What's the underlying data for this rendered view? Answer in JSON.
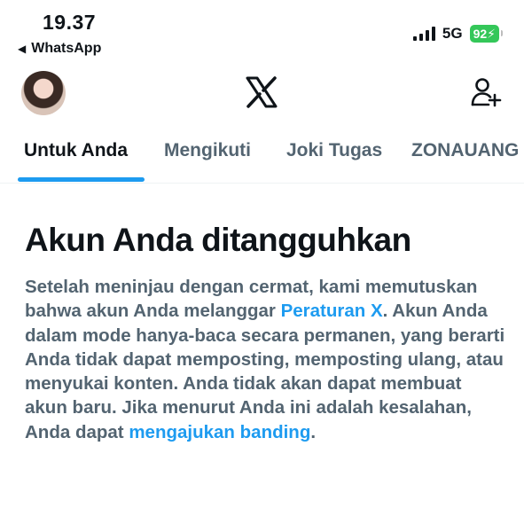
{
  "status_bar": {
    "time": "19.37",
    "back_app": "WhatsApp",
    "network": "5G",
    "battery": "92"
  },
  "header": {
    "avatar_icon": "user-avatar",
    "logo_icon": "x-logo-icon",
    "follow_icon": "add-user-icon"
  },
  "tabs": [
    {
      "label": "Untuk Anda"
    },
    {
      "label": "Mengikuti"
    },
    {
      "label": "Joki Tugas"
    },
    {
      "label": "ZONAUANG"
    }
  ],
  "message": {
    "title": "Akun Anda ditangguhkan",
    "text_1": "Setelah meninjau dengan cermat, kami memutuskan bahwa akun Anda melanggar ",
    "rules_link": "Peraturan X",
    "text_2": ". Akun Anda dalam mode hanya-baca secara permanen, yang berarti Anda tidak dapat memposting, memposting ulang, atau menyukai konten. Anda tidak akan dapat membuat akun baru. Jika menurut Anda ini adalah kesalahan, Anda dapat ",
    "appeal_link": "mengajukan banding",
    "text_3": "."
  },
  "colors": {
    "accent": "#1d9bf0",
    "battery": "#34c759"
  }
}
